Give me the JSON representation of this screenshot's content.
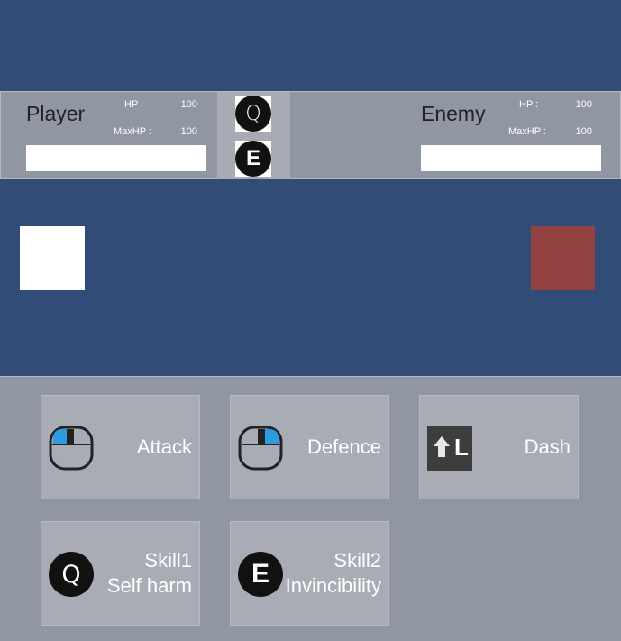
{
  "player": {
    "name": "Player",
    "hp_label": "HP :",
    "hp": "100",
    "maxhp_label": "MaxHP :",
    "maxhp": "100",
    "hp_fraction": 1.0
  },
  "enemy": {
    "name": "Enemy",
    "hp_label": "HP :",
    "hp": "100",
    "maxhp_label": "MaxHP :",
    "maxhp": "100",
    "hp_fraction": 1.0
  },
  "skill_keys": [
    "Q",
    "E"
  ],
  "actions": [
    {
      "label_lines": [
        "Attack"
      ],
      "icon": "mouse-left-click-icon"
    },
    {
      "label_lines": [
        "Defence"
      ],
      "icon": "mouse-right-click-icon"
    },
    {
      "label_lines": [
        "Dash"
      ],
      "icon": "shift-l-key-icon"
    },
    {
      "label_lines": [
        "Skill1",
        "Self harm"
      ],
      "icon": "q-key-icon"
    },
    {
      "label_lines": [
        "Skill2",
        "Invincibility"
      ],
      "icon": "e-key-icon"
    }
  ],
  "dash_key": "L",
  "colors": {
    "background": "#314d77",
    "hud": "#9196a3",
    "player": "#ffffff",
    "enemy": "#934141",
    "mouse_highlight": "#2e9be0",
    "button": "#a9acb5"
  }
}
